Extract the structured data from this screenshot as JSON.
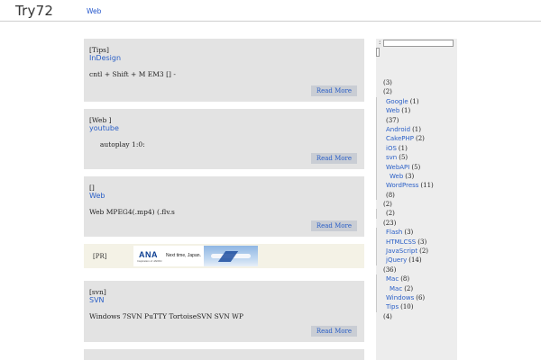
{
  "header": {
    "logo": "Try72",
    "nav_web": "Web"
  },
  "posts": [
    {
      "category": "[Tips]",
      "title": "InDesign",
      "excerpt": "cntl + Shift + M  EM3 [] -",
      "read_more": "Read More"
    },
    {
      "category": "[Web ]",
      "title": " youtube",
      "excerpt": "     autoplay 1:0:",
      "read_more": "Read More"
    },
    {
      "category": "[]",
      "title": "Web",
      "excerpt": "Web  MPEG4(.mp4) (.flv.s",
      "read_more": "Read More"
    },
    {
      "category": "[svn]",
      "title": "SVN",
      "excerpt": "Windows 7SVN PuTTY TortoiseSVN SVN WP",
      "read_more": "Read More"
    }
  ],
  "ad": {
    "label": "[PR]",
    "banner_logo": "ANA",
    "banner_sub": "Inspiration of JAPAN",
    "banner_text": "Next time, Japan."
  },
  "sidebar": {
    "search_label": ":",
    "items": [
      {
        "label": "",
        "count": "(3)",
        "indent": 0
      },
      {
        "label": "",
        "count": "(2)",
        "indent": 0
      },
      {
        "label": "Google",
        "count": "(1)",
        "indent": 1
      },
      {
        "label": "Web",
        "count": "(1)",
        "indent": 1
      },
      {
        "label": "",
        "count": "(37)",
        "indent": 1
      },
      {
        "label": "Android",
        "count": "(1)",
        "indent": 1
      },
      {
        "label": "CakePHP",
        "count": "(2)",
        "indent": 1
      },
      {
        "label": "iOS",
        "count": "(1)",
        "indent": 1
      },
      {
        "label": "svn",
        "count": "(5)",
        "indent": 1
      },
      {
        "label": "WebAPI",
        "count": "(5)",
        "indent": 1
      },
      {
        "label": "Web",
        "count": "(3)",
        "indent": 2
      },
      {
        "label": "WordPress",
        "count": "(11)",
        "indent": 1
      },
      {
        "label": "",
        "count": "(8)",
        "indent": 1
      },
      {
        "label": "",
        "count": "(2)",
        "indent": 0
      },
      {
        "label": "",
        "count": "(2)",
        "indent": 1
      },
      {
        "label": "",
        "count": "(23)",
        "indent": 0
      },
      {
        "label": "Flash",
        "count": "(3)",
        "indent": 1
      },
      {
        "label": "HTMLCSS",
        "count": "(3)",
        "indent": 1
      },
      {
        "label": "JavaScript",
        "count": "(2)",
        "indent": 1
      },
      {
        "label": "jQuery",
        "count": "(14)",
        "indent": 1
      },
      {
        "label": "",
        "count": "(36)",
        "indent": 0
      },
      {
        "label": "Mac",
        "count": "(8)",
        "indent": 1
      },
      {
        "label": "Mac",
        "count": "(2)",
        "indent": 2
      },
      {
        "label": "Windows",
        "count": "(6)",
        "indent": 1
      },
      {
        "label": "Tips",
        "count": "(10)",
        "indent": 1
      },
      {
        "label": "",
        "count": "(4)",
        "indent": 0
      }
    ]
  }
}
